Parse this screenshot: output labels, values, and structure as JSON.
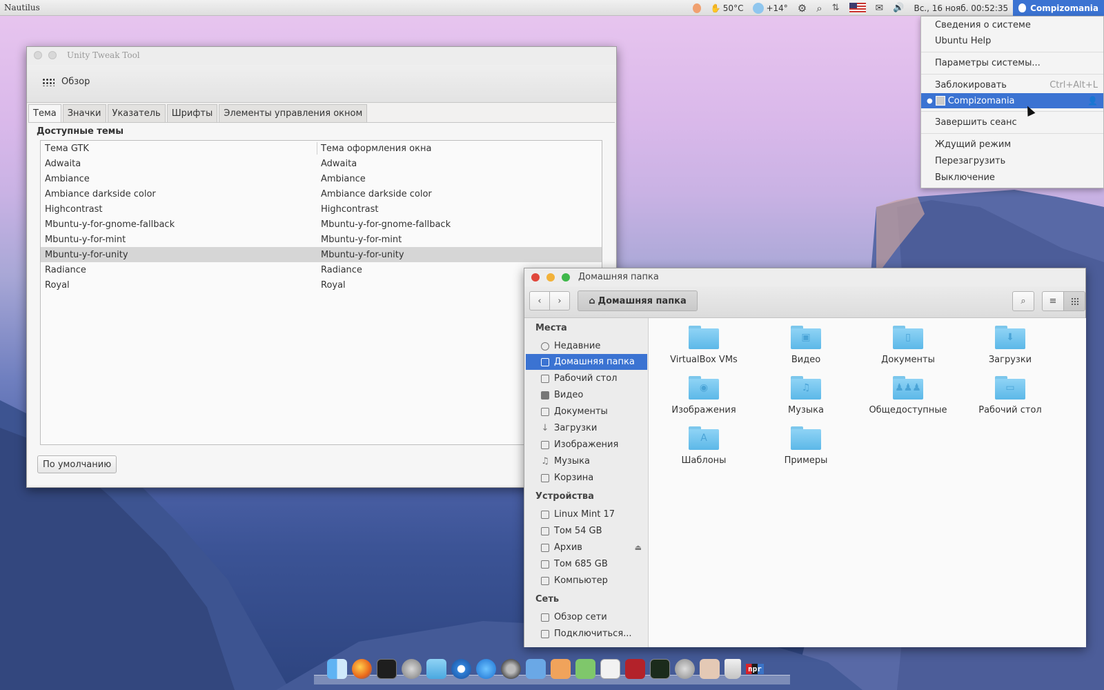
{
  "top_panel": {
    "app_name": "Nautilus",
    "cpu_temp": "50°C",
    "weather": "+14°",
    "datetime": "Вс., 16 нояб. 00:52:35",
    "user": "Compizomania"
  },
  "user_menu": {
    "items": [
      {
        "label": "Сведения о системе"
      },
      {
        "label": "Ubuntu Help"
      },
      {
        "label": "Параметры системы..."
      },
      {
        "label": "Заблокировать",
        "shortcut": "Ctrl+Alt+L"
      },
      {
        "label": "Compizomania"
      },
      {
        "label": "Завершить сеанс"
      },
      {
        "label": "Ждущий режим"
      },
      {
        "label": "Перезагрузить"
      },
      {
        "label": "Выключение"
      }
    ]
  },
  "tweak_tool": {
    "title": "Unity Tweak Tool",
    "overview": "Обзор",
    "tabs": [
      "Тема",
      "Значки",
      "Указатель",
      "Шрифты",
      "Элементы управления окном"
    ],
    "section_title": "Доступные темы",
    "columns": [
      "Тема GTK",
      "Тема оформления окна"
    ],
    "rows": [
      [
        "Adwaita",
        "Adwaita"
      ],
      [
        "Ambiance",
        "Ambiance"
      ],
      [
        "Ambiance darkside color",
        "Ambiance darkside color"
      ],
      [
        "Highcontrast",
        "Highcontrast"
      ],
      [
        "Mbuntu-y-for-gnome-fallback",
        "Mbuntu-y-for-gnome-fallback"
      ],
      [
        "Mbuntu-y-for-mint",
        "Mbuntu-y-for-mint"
      ],
      [
        "Mbuntu-y-for-unity",
        "Mbuntu-y-for-unity"
      ],
      [
        "Radiance",
        "Radiance"
      ],
      [
        "Royal",
        "Royal"
      ]
    ],
    "default_button": "По умолчанию"
  },
  "nautilus": {
    "title": "Домашняя папка",
    "path_button": "Домашняя папка",
    "sidebar": {
      "places_heading": "Места",
      "places": [
        "Недавние",
        "Домашняя папка",
        "Рабочий стол",
        "Видео",
        "Документы",
        "Загрузки",
        "Изображения",
        "Музыка",
        "Корзина"
      ],
      "devices_heading": "Устройства",
      "devices": [
        "Linux Mint 17",
        "Том 54 GB",
        "Архив",
        "Том 685 GB",
        "Компьютер"
      ],
      "network_heading": "Сеть",
      "network": [
        "Обзор сети",
        "Подключиться..."
      ]
    },
    "files": [
      "VirtualBox VMs",
      "Видео",
      "Документы",
      "Загрузки",
      "Изображения",
      "Музыка",
      "Общедоступные",
      "Рабочий стол",
      "Шаблоны",
      "Примеры"
    ]
  },
  "dock": {
    "npr_label": "npr"
  },
  "colors": {
    "accent": "#3b73d2",
    "folder": "#6cc2ef",
    "close": "#e0473c",
    "minimize": "#f2b23a",
    "maximize": "#3fb84b"
  }
}
